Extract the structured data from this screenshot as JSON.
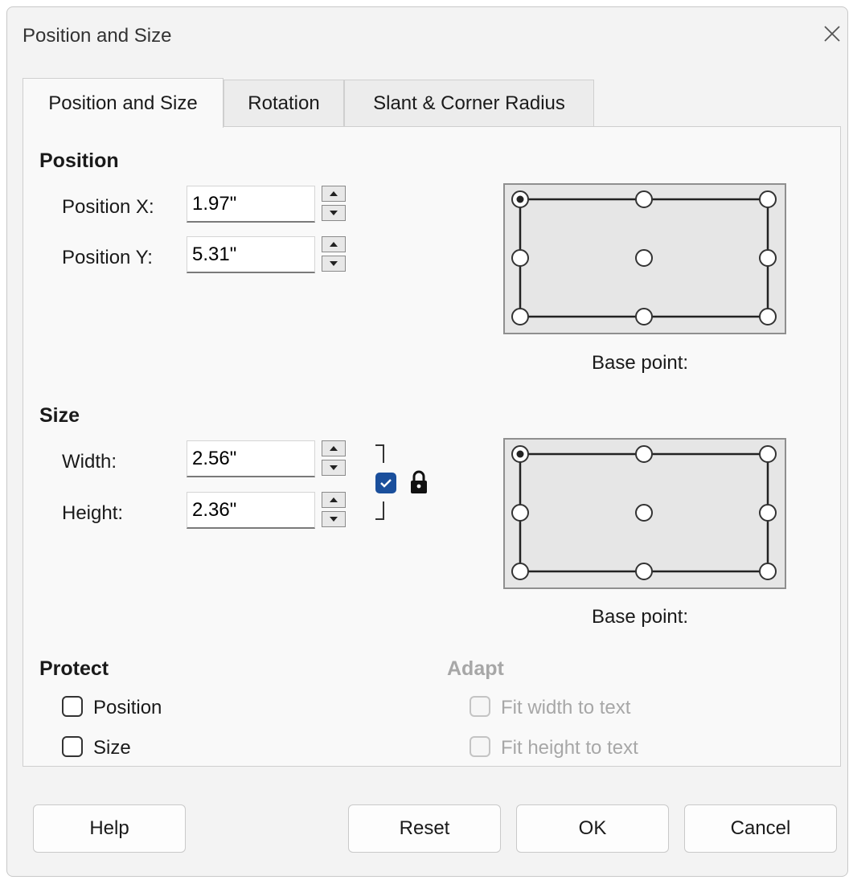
{
  "dialog": {
    "title": "Position and Size"
  },
  "tabs": [
    {
      "label": "Position and Size",
      "active": true
    },
    {
      "label": "Rotation",
      "active": false
    },
    {
      "label": "Slant & Corner Radius",
      "active": false
    }
  ],
  "position": {
    "heading": "Position",
    "x": {
      "label": "Position X:",
      "value": "1.97\""
    },
    "y": {
      "label": "Position Y:",
      "value": "5.31\""
    },
    "base_point_label": "Base point:",
    "base_point_selected": "top-left"
  },
  "size": {
    "heading": "Size",
    "width": {
      "label": "Width:",
      "value": "2.56\""
    },
    "height": {
      "label": "Height:",
      "value": "2.36\""
    },
    "keep_ratio_checked": true,
    "base_point_label": "Base point:",
    "base_point_selected": "top-left"
  },
  "protect": {
    "heading": "Protect",
    "position_label": "Position",
    "position_checked": false,
    "size_label": "Size",
    "size_checked": false
  },
  "adapt": {
    "heading": "Adapt",
    "fit_width_label": "Fit width to text",
    "fit_height_label": "Fit height to text",
    "enabled": false
  },
  "buttons": {
    "help": "Help",
    "reset": "Reset",
    "ok": "OK",
    "cancel": "Cancel"
  },
  "colors": {
    "accent": "#1a4f9c",
    "dialog_bg": "#f3f3f3",
    "panel_bg": "#f9f9f9"
  }
}
